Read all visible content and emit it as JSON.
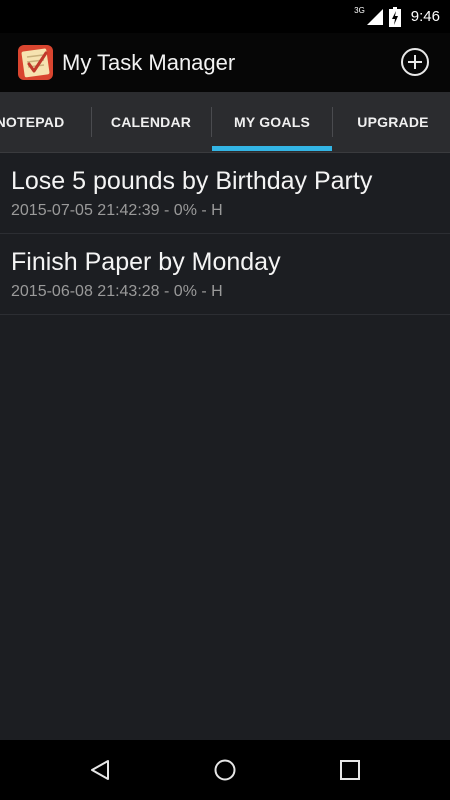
{
  "status_bar": {
    "network": "3G",
    "time": "9:46",
    "icons": [
      "signal-icon",
      "battery-charging-icon"
    ]
  },
  "action_bar": {
    "app_icon": "notepad-checkmark-icon",
    "title": "My Task Manager",
    "add_icon": "add-circle-icon"
  },
  "tabs": [
    {
      "label": "NOTEPAD",
      "selected": false
    },
    {
      "label": "CALENDAR",
      "selected": false
    },
    {
      "label": "MY GOALS",
      "selected": true
    },
    {
      "label": "UPGRADE",
      "selected": false
    }
  ],
  "goals": [
    {
      "title": "Lose 5 pounds by Birthday Party",
      "meta": "2015-07-05 21:42:39 - 0% - H"
    },
    {
      "title": "Finish Paper by Monday",
      "meta": "2015-06-08 21:43:28 - 0% - H"
    }
  ],
  "nav_bar": {
    "icons": [
      "back-icon",
      "home-icon",
      "recents-icon"
    ]
  },
  "colors": {
    "accent": "#33b5e5",
    "background": "#1c1e22",
    "tab_bar": "#2b2c2f"
  }
}
